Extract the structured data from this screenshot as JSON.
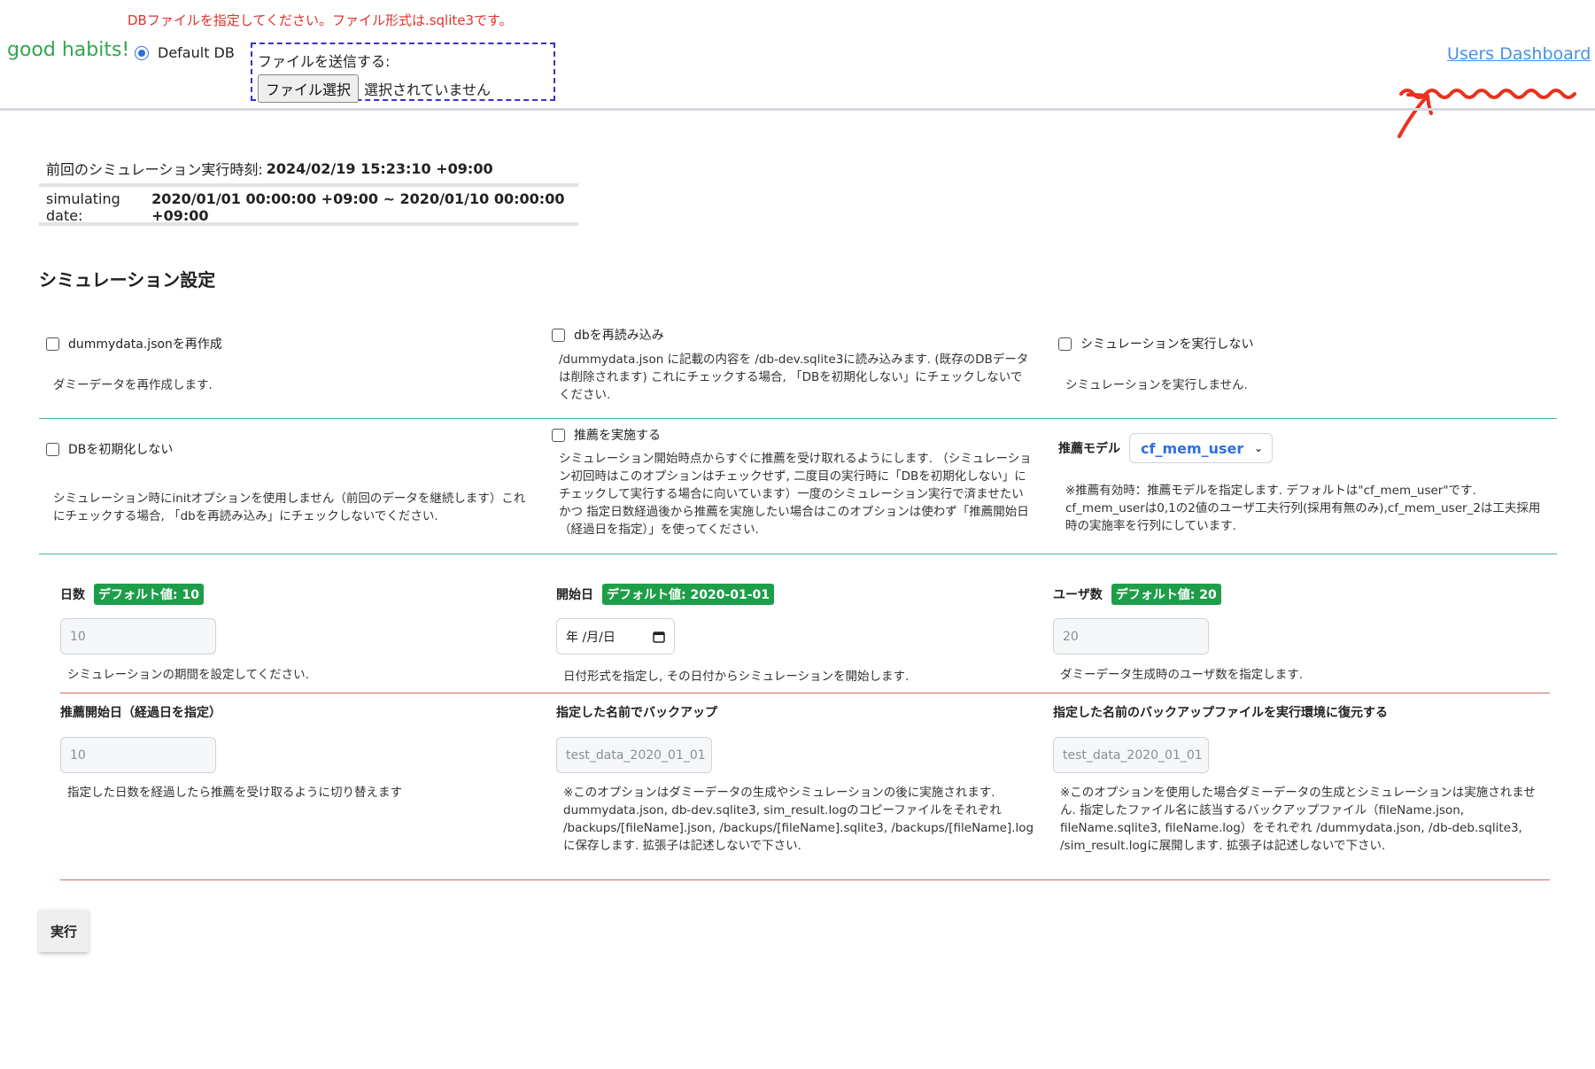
{
  "header": {
    "warning": "DBファイルを指定してください。ファイル形式は.sqlite3です。",
    "brand": "good habits!",
    "radio_label": "Default DB",
    "upload_label": "ファイルを送信する:",
    "file_button": "ファイル選択",
    "file_status": "選択されていません",
    "users_link": "Users Dashboard"
  },
  "info": {
    "last_run_label": "前回のシミュレーション実行時刻:",
    "last_run_value": "2024/02/19 15:23:10 +09:00",
    "sim_date_label": "simulating date:",
    "sim_date_value": "2020/01/01 00:00:00 +09:00 ~ 2020/01/10 00:00:00 +09:00"
  },
  "section_title": "シミュレーション設定",
  "options": {
    "dummy": {
      "label": "dummydata.jsonを再作成",
      "desc": "ダミーデータを再作成します."
    },
    "reload": {
      "label": "dbを再読み込み",
      "desc": "/dummydata.json に記載の内容を /db-dev.sqlite3に読み込みます. (既存のDBデータは削除されます) これにチェックする場合, 「DBを初期化しない」にチェックしないでください."
    },
    "no_sim": {
      "label": "シミュレーションを実行しない",
      "desc": "シミュレーションを実行しません."
    },
    "no_init": {
      "label": "DBを初期化しない",
      "desc": "シミュレーション時にinitオプションを使用しません（前回のデータを継続します）これにチェックする場合, 「dbを再読み込み」にチェックしないでください."
    },
    "recommend": {
      "label": "推薦を実施する",
      "desc": "シミュレーション開始時点からすぐに推薦を受け取れるようにします. （シミュレーション初回時はこのオプションはチェックせず, 二度目の実行時に「DBを初期化しない」にチェックして実行する場合に向いています）一度のシミュレーション実行で済ませたい かつ 指定日数経過後から推薦を実施したい場合はこのオプションは使わず「推薦開始日（経過日を指定）」を使ってください."
    },
    "model": {
      "label": "推薦モデル",
      "selected": "cf_mem_user",
      "desc": "※推薦有効時：推薦モデルを指定します. デフォルトは\"cf_mem_user\"です. cf_mem_userは0,1の2値のユーザ工夫行列(採用有無のみ),cf_mem_user_2は工夫採用時の実施率を行列にしています."
    }
  },
  "fields": {
    "days": {
      "label": "日数",
      "badge": "デフォルト値: 10",
      "placeholder": "10",
      "desc": "シミュレーションの期間を設定してください."
    },
    "start": {
      "label": "開始日",
      "badge": "デフォルト値: 2020-01-01",
      "placeholder": "年 /月/日",
      "desc": "日付形式を指定し, その日付からシミュレーションを開始します."
    },
    "users": {
      "label": "ユーザ数",
      "badge": "デフォルト値: 20",
      "placeholder": "20",
      "desc": "ダミーデータ生成時のユーザ数を指定します."
    },
    "rec_start": {
      "label": "推薦開始日（経過日を指定）",
      "placeholder": "10",
      "desc": "指定した日数を経過したら推薦を受け取るように切り替えます"
    },
    "backup": {
      "label": "指定した名前でバックアップ",
      "placeholder": "test_data_2020_01_01",
      "desc": "※このオプションはダミーデータの生成やシミュレーションの後に実施されます. dummydata.json, db-dev.sqlite3, sim_result.logのコピーファイルをそれぞれ /backups/[fileName].json, /backups/[fileName].sqlite3, /backups/[fileName].log に保存します. 拡張子は記述しないで下さい."
    },
    "restore": {
      "label": "指定した名前のバックアップファイルを実行環境に復元する",
      "placeholder": "test_data_2020_01_01",
      "desc": "※このオプションを使用した場合ダミーデータの生成とシミュレーションは実施されません. 指定したファイル名に該当するバックアップファイル（fileName.json, fileName.sqlite3, fileName.log）をそれぞれ /dummydata.json, /db-deb.sqlite3, /sim_result.logに展開します. 拡張子は記述しないで下さい."
    }
  },
  "run_button": "実行",
  "colors": {
    "brand": "#2fa84f",
    "warning": "#e0322d",
    "badge": "#1f9e4a",
    "link": "#4a8fe8",
    "teal_divider": "#4fb3a9",
    "red_divider": "#e06666",
    "annotation": "#e8321e"
  }
}
